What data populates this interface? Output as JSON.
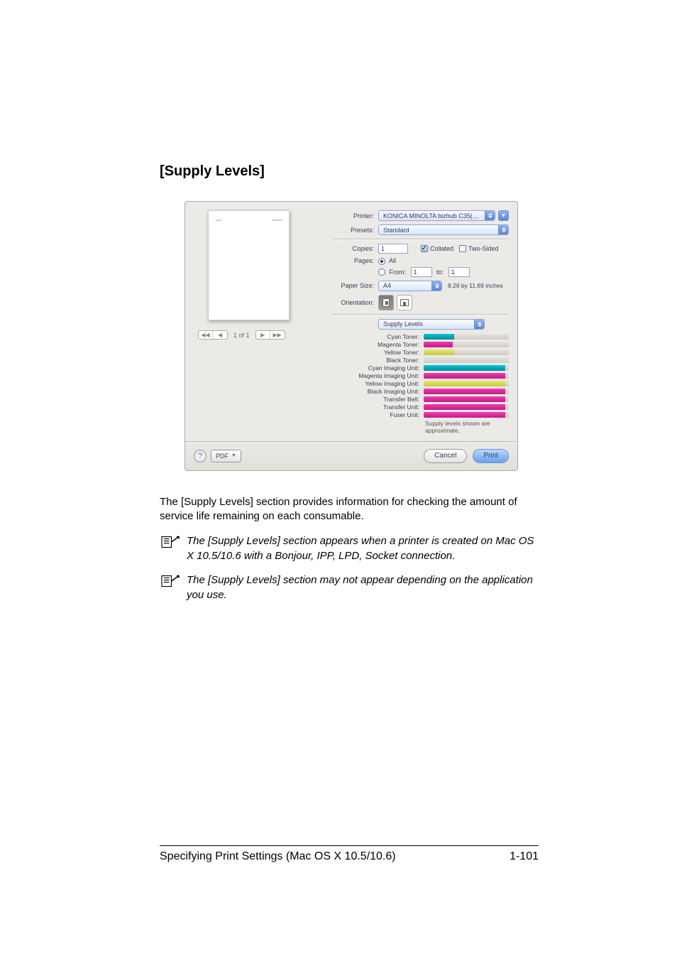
{
  "heading": "[Supply Levels]",
  "dialog": {
    "printer_label": "Printer:",
    "printer_value": "KONICA MINOLTA bizhub C35(…",
    "presets_label": "Presets:",
    "presets_value": "Standard",
    "copies_label": "Copies:",
    "copies_value": "1",
    "collated_label": "Collated",
    "twosided_label": "Two-Sided",
    "pages_label": "Pages:",
    "pages_all": "All",
    "pages_from": "From:",
    "pages_from_val": "1",
    "pages_to": "to:",
    "pages_to_val": "1",
    "paper_size_label": "Paper Size:",
    "paper_size_value": "A4",
    "paper_dims": "8.26 by 11.69 inches",
    "orientation_label": "Orientation:",
    "section_select": "Supply Levels",
    "supplies": [
      {
        "name": "Cyan Toner:",
        "pct": 36,
        "cls": "cyan"
      },
      {
        "name": "Magenta Toner:",
        "pct": 34,
        "cls": "magenta"
      },
      {
        "name": "Yellow Toner:",
        "pct": 36,
        "cls": "yellow"
      },
      {
        "name": "Black Toner:",
        "pct": 0,
        "cls": "black"
      },
      {
        "name": "Cyan Imaging Unit:",
        "pct": 96,
        "cls": "cyan"
      },
      {
        "name": "Magenta Imaging Unit:",
        "pct": 96,
        "cls": "magenta"
      },
      {
        "name": "Yellow Imaging Unit:",
        "pct": 96,
        "cls": "yellow"
      },
      {
        "name": "Black Imaging Unit:",
        "pct": 96,
        "cls": "mag2"
      },
      {
        "name": "Transfer Belt:",
        "pct": 96,
        "cls": "gen"
      },
      {
        "name": "Transfer Unit:",
        "pct": 96,
        "cls": "gen"
      },
      {
        "name": "Fuser Unit:",
        "pct": 96,
        "cls": "gen"
      }
    ],
    "approx": "Supply levels shown are approximate.",
    "help": "?",
    "pdf": "PDF",
    "cancel": "Cancel",
    "print": "Print",
    "pager": "1 of 1"
  },
  "body": "The [Supply Levels] section provides information for checking the amount of service life remaining on each consumable.",
  "note1": "The [Supply Levels] section appears when a printer is created on Mac OS X 10.5/10.6 with a Bonjour, IPP, LPD, Socket connection.",
  "note2": "The [Supply Levels] section may not appear depending on the application you use.",
  "footer_left": "Specifying Print Settings (Mac OS X 10.5/10.6)",
  "footer_right": "1-101"
}
